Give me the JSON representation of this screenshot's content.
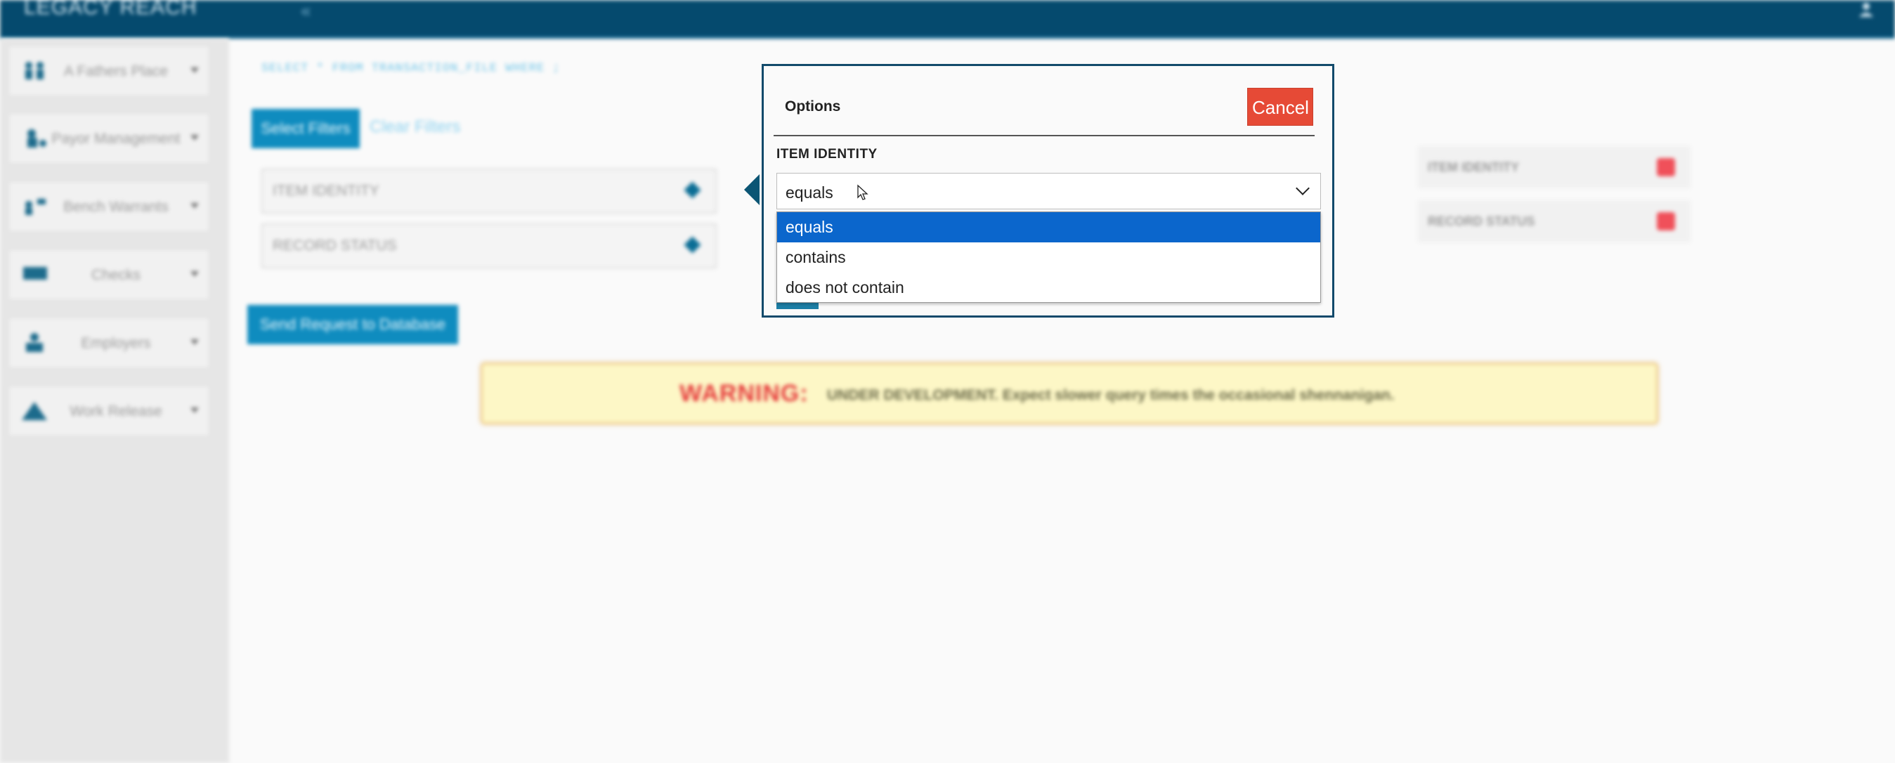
{
  "topbar": {
    "logo": "LEGACY REACH",
    "collapse_glyph": "«",
    "user_icon": "user-icon",
    "bg_color": "#054a6e"
  },
  "sidebar": {
    "items": [
      {
        "label": "A Fathers Place",
        "icon": "family-icon"
      },
      {
        "label": "Payor Management",
        "icon": "payor-icon"
      },
      {
        "label": "Bench Warrants",
        "icon": "warrant-icon"
      },
      {
        "label": "Checks",
        "icon": "check-icon"
      },
      {
        "label": "Employers",
        "icon": "employer-icon"
      },
      {
        "label": "Work Release",
        "icon": "work-release-icon"
      }
    ]
  },
  "main": {
    "sql": "SELECT * FROM TRANSACTION_FILE WHERE ;",
    "select_filters_label": "Select Filters",
    "clear_filters_label": "Clear Filters",
    "filters": [
      "ITEM IDENTITY",
      "RECORD STATUS"
    ],
    "send_request_label": "Send Request to Database"
  },
  "warning": {
    "title": "WARNING:",
    "text": "UNDER DEVELOPMENT. Expect slower query times the occasional shennanigan."
  },
  "right_panel": {
    "selected": [
      "ITEM IDENTITY",
      "RECORD STATUS"
    ]
  },
  "modal": {
    "title": "Options",
    "cancel_label": "Cancel",
    "field_label": "ITEM IDENTITY",
    "selected_value": "equals",
    "options": [
      "equals",
      "contains",
      "does not contain"
    ],
    "colors": {
      "accent": "#0b66cc",
      "cancel": "#e64a36",
      "border": "#124a6b"
    }
  }
}
